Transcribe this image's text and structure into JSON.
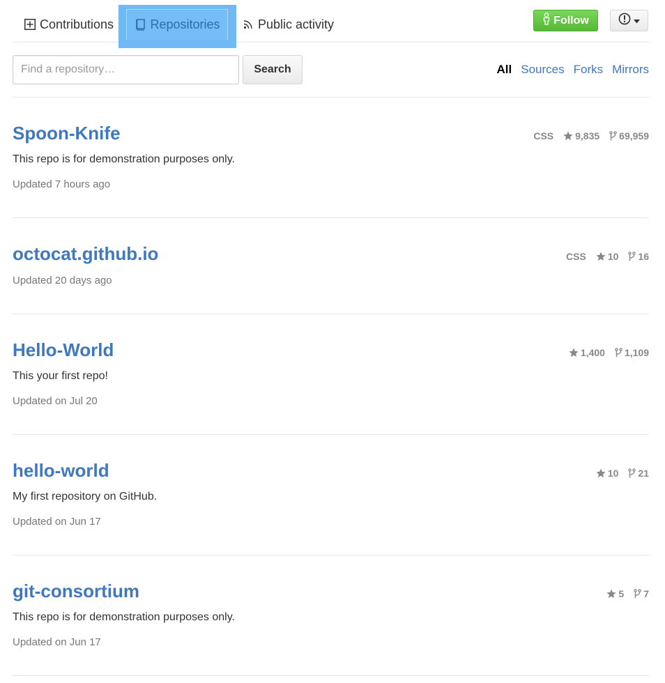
{
  "tabs": {
    "contributions": "Contributions",
    "repositories": "Repositories",
    "public_activity": "Public activity"
  },
  "follow": {
    "label": "Follow",
    "color": "#6cc644"
  },
  "search": {
    "placeholder": "Find a repository…",
    "button": "Search"
  },
  "filters": {
    "all": "All",
    "sources": "Sources",
    "forks": "Forks",
    "mirrors": "Mirrors"
  },
  "colors": {
    "link": "#4078c0",
    "highlight": "#6fbaf6"
  },
  "repos": [
    {
      "name": "Spoon-Knife",
      "description": "This repo is for demonstration purposes only.",
      "updated": "Updated 7 hours ago",
      "language": "CSS",
      "stars": "9,835",
      "forks": "69,959"
    },
    {
      "name": "octocat.github.io",
      "description": "",
      "updated": "Updated 20 days ago",
      "language": "CSS",
      "stars": "10",
      "forks": "16"
    },
    {
      "name": "Hello-World",
      "description": "This your first repo!",
      "updated": "Updated on Jul 20",
      "language": "",
      "stars": "1,400",
      "forks": "1,109"
    },
    {
      "name": "hello-world",
      "description": "My first repository on GitHub.",
      "updated": "Updated on Jun 17",
      "language": "",
      "stars": "10",
      "forks": "21"
    },
    {
      "name": "git-consortium",
      "description": "This repo is for demonstration purposes only.",
      "updated": "Updated on Jun 17",
      "language": "",
      "stars": "5",
      "forks": "7"
    }
  ]
}
